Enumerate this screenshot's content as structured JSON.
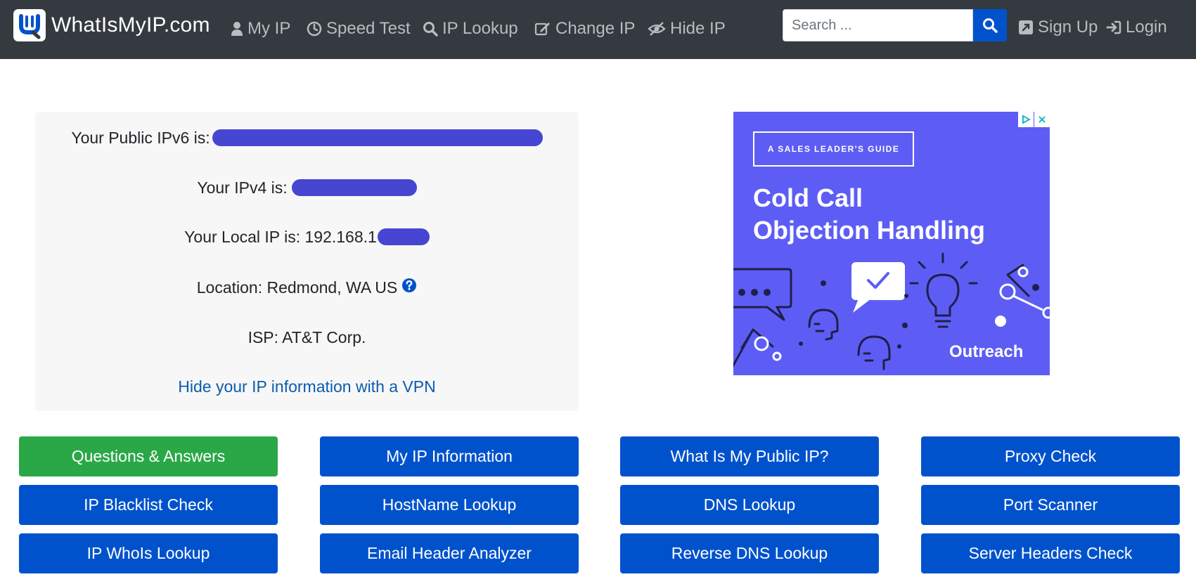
{
  "brand": {
    "name": "WhatIsMyIP.com"
  },
  "nav": {
    "items": [
      {
        "label": "My IP",
        "icon": "user-icon"
      },
      {
        "label": "Speed Test",
        "icon": "clock-icon"
      },
      {
        "label": "IP Lookup",
        "icon": "search-icon"
      },
      {
        "label": "Change IP",
        "icon": "edit-icon"
      },
      {
        "label": "Hide IP",
        "icon": "eye-slash-icon"
      }
    ],
    "search_placeholder": "Search ...",
    "signup_label": "Sign Up",
    "login_label": "Login"
  },
  "ip_info": {
    "ipv6_label": "Your Public IPv6 is:",
    "ipv4_label": "Your IPv4 is:",
    "local_ip_label": "Your Local IP is: 192.168.1",
    "location": "Location: Redmond, WA US",
    "isp": "ISP: AT&T Corp.",
    "vpn_link": "Hide your IP information with a VPN"
  },
  "ad": {
    "tag": "A SALES LEADER'S GUIDE",
    "headline_line1": "Cold Call",
    "headline_line2": "Objection Handling",
    "brand": "Outreach"
  },
  "tools": [
    {
      "label": "Questions & Answers",
      "style": "green"
    },
    {
      "label": "My IP Information",
      "style": "blue"
    },
    {
      "label": "What Is My Public IP?",
      "style": "blue"
    },
    {
      "label": "Proxy Check",
      "style": "blue"
    },
    {
      "label": "IP Blacklist Check",
      "style": "blue"
    },
    {
      "label": "HostName Lookup",
      "style": "blue"
    },
    {
      "label": "DNS Lookup",
      "style": "blue"
    },
    {
      "label": "Port Scanner",
      "style": "blue"
    },
    {
      "label": "IP WhoIs Lookup",
      "style": "blue"
    },
    {
      "label": "Email Header Analyzer",
      "style": "blue"
    },
    {
      "label": "Reverse DNS Lookup",
      "style": "blue"
    },
    {
      "label": "Server Headers Check",
      "style": "blue"
    }
  ],
  "colors": {
    "navbar": "#343a40",
    "primary": "#0052cc",
    "success": "#2aa847",
    "link": "#0b5cad",
    "ad_background": "#5d5df5",
    "redaction": "#4646d2"
  }
}
